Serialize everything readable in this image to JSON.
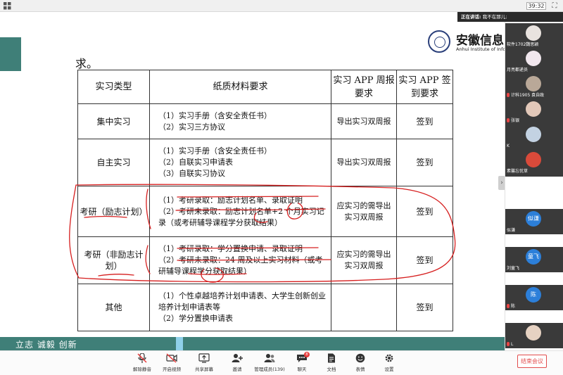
{
  "window": {
    "timer": "39:32"
  },
  "speaking": {
    "label": "正在讲话:",
    "name": "我不在那儿;"
  },
  "slide": {
    "paragraph_tail": "求。",
    "logo_cn": "安徽信息",
    "logo_en": "Anhui Institute of Info",
    "footer_motto": "立志 诚毅 创新",
    "table": {
      "headers": [
        "实习类型",
        "纸质材料要求",
        "实习 APP 周报要求",
        "实习 APP 签到要求"
      ],
      "rows": [
        {
          "type": "集中实习",
          "items": [
            "（1）实习手册（含安全责任书）",
            "（2）实习三方协议"
          ],
          "weekly": "导出实习双周报",
          "checkin": "签到"
        },
        {
          "type": "自主实习",
          "items": [
            "（1）实习手册（含安全责任书）",
            "（2）自联实习申请表",
            "（3）自联实习协议"
          ],
          "weekly": "导出实习双周报",
          "checkin": "签到"
        },
        {
          "type": "考研（励志计划）",
          "items": [
            "（1）考研录取：励志计划名单、录取证明",
            "（2）考研未录取：励志计划名单+2 个月实习记录（或考研辅导课程学分获取结果）"
          ],
          "weekly": "应实习的需导出实习双周报",
          "checkin": "签到"
        },
        {
          "type": "考研（非励志计划）",
          "items": [
            "（1）考研录取：学分置换申请、录取证明",
            "（2）考研未录取：24 周及以上实习材料（或考研辅导课程学分获取结果）"
          ],
          "weekly": "应实习的需导出实习双周报",
          "checkin": "签到"
        },
        {
          "type": "其他",
          "items": [
            "（1）个性卓越培养计划申请表、大学生创新创业培养计划申请表等",
            "（2）学分置换申请表"
          ],
          "weekly": "",
          "checkin": "签到"
        }
      ]
    }
  },
  "participants": [
    {
      "name": "软件1702魏思颖",
      "muted": false,
      "avatar": "cat"
    },
    {
      "name": "月亮都递员",
      "muted": false,
      "avatar": "bunny"
    },
    {
      "name": "计科1905 袁自政",
      "muted": true,
      "avatar": "photo"
    },
    {
      "name": "张银",
      "muted": true,
      "avatar": "girl"
    },
    {
      "name": "K",
      "muted": false,
      "avatar": "cartoon"
    },
    {
      "name": "素馨忘忧草",
      "muted": false,
      "avatar": "red"
    },
    {
      "name": "似谦",
      "muted": false,
      "avatar": "text",
      "avatar_text": "似谦"
    },
    {
      "name": "刘童飞",
      "muted": false,
      "avatar": "text",
      "avatar_text": "童飞"
    },
    {
      "name": "陈",
      "muted": true,
      "avatar": "text",
      "avatar_text": "陈"
    },
    {
      "name": "L",
      "muted": true,
      "avatar": "girl2"
    }
  ],
  "toolbar": {
    "mute": "解除静音",
    "video": "开启视频",
    "share": "共享屏幕",
    "invite": "邀请",
    "members": "管理成员(139)",
    "chat": "聊天",
    "chat_badge": "8",
    "docs": "文档",
    "reactions": "表情",
    "settings": "设置",
    "end": "结束会议"
  },
  "colors": {
    "slide_accent": "#3f7f78",
    "end_red": "#e24c4c",
    "tile_bg": "#3a3a3a",
    "avatar_blue": "#2c7fd9",
    "annotation": "#d61f1f"
  }
}
